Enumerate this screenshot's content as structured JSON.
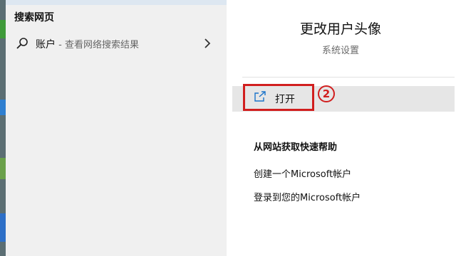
{
  "left_panel": {
    "section_title": "搜索网页",
    "result": {
      "icon": "search-icon",
      "label": "账户",
      "sublabel": " - 查看网络搜索结果",
      "chevron_icon": "chevron-right-icon"
    }
  },
  "right_panel": {
    "title": "更改用户头像",
    "subtitle": "系统设置",
    "open_action": {
      "icon": "open-external-icon",
      "label": "打开"
    },
    "annotation_marker": "2",
    "help_section": {
      "title": "从网站获取快速帮助",
      "links": [
        "创建一个Microsoft帐户",
        "登录到您的Microsoft帐户"
      ]
    }
  },
  "colors": {
    "highlight_border": "#d11e1e",
    "left_bg": "#f0f0f0",
    "accent": "#1a73c9"
  }
}
